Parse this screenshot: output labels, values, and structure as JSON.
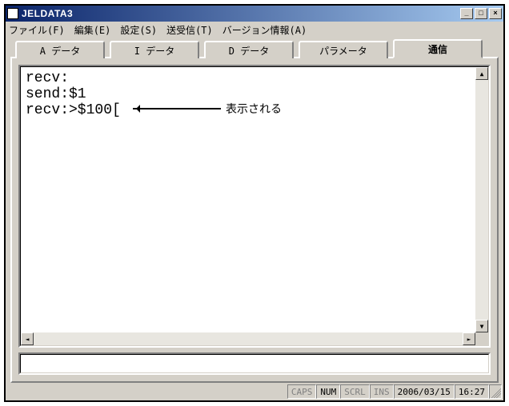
{
  "window": {
    "title": "JELDATA3"
  },
  "menu": {
    "file": "ファイル(F)",
    "edit": "編集(E)",
    "settings": "設定(S)",
    "sendrecv": "送受信(T)",
    "version": "バージョン情報(A)"
  },
  "tabs": {
    "items": [
      {
        "label": "A データ",
        "name": "tab-a-data"
      },
      {
        "label": "I データ",
        "name": "tab-i-data"
      },
      {
        "label": "D データ",
        "name": "tab-d-data"
      },
      {
        "label": "パラメータ",
        "name": "tab-parameter"
      },
      {
        "label": "通信",
        "name": "tab-comm"
      }
    ],
    "active_index": 4
  },
  "terminal": {
    "lines": [
      "recv:",
      "send:$1",
      "recv:>$100["
    ]
  },
  "annotation": {
    "text": "表示される"
  },
  "input": {
    "value": ""
  },
  "status": {
    "caps": "CAPS",
    "num": "NUM",
    "scrl": "SCRL",
    "ins": "INS",
    "date": "2006/03/15",
    "time": "16:27",
    "caps_on": false,
    "num_on": true,
    "scrl_on": false,
    "ins_on": false
  }
}
